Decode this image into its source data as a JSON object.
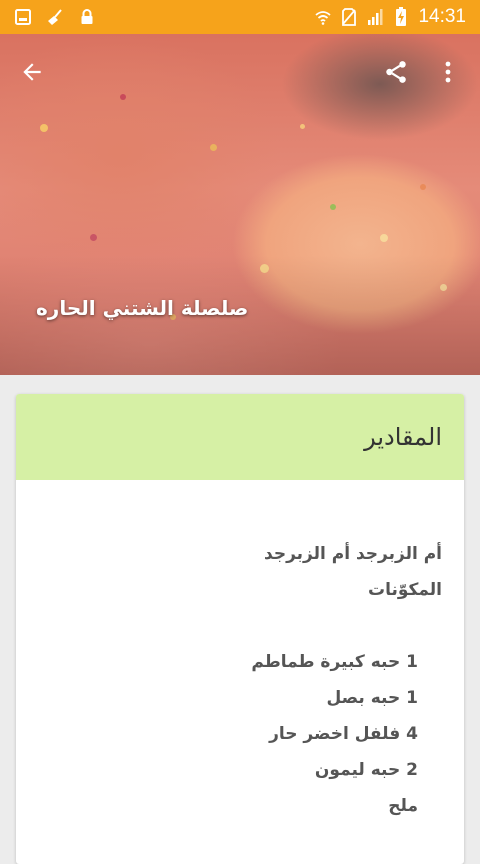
{
  "status_bar": {
    "time": "14:31",
    "left_icons": [
      "gallery-icon",
      "broom-icon",
      "lock-icon"
    ],
    "right_icons": [
      "wifi-icon",
      "no-sim-icon",
      "signal-icon",
      "battery-charging-icon"
    ]
  },
  "hero": {
    "title": "صلصلة الشتني الحاره",
    "back_icon": "arrow-back-icon",
    "share_icon": "share-icon",
    "menu_icon": "more-vert-icon"
  },
  "card": {
    "title": "المقادير",
    "intro": "أم الزبرجد أم الزبرجد",
    "ingredients_heading": "المكوّنات",
    "ingredients": [
      "1 حبه كبيرة طماطم",
      "1 حبه بصل",
      "4 فلفل اخضر حار",
      "2 حبه ليمون",
      "ملح"
    ]
  },
  "colors": {
    "status_bar": "#f6a31b",
    "card_header": "#d6f0a5",
    "background": "#ececec"
  }
}
